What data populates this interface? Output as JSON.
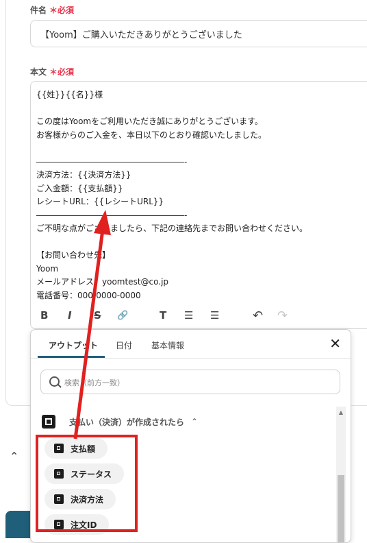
{
  "subject": {
    "label": "件名",
    "required": "＊必須",
    "value": "【Yoom】ご購入いただきありがとうございました"
  },
  "body": {
    "label": "本文",
    "required": "＊必須",
    "text": "{{姓}}{{名}}様\n\nこの度はYoomをご利用いただき誠にありがとうございます。\nお客様からのご入金を、本日以下のとおり確認いたしました。\n\n――――――――――――――――――-\n決済方法：{{決済方法}}\nご入金額：{{支払額}}\nレシートURL：{{レシートURL}}\n――――――――――――――――――-\nご不明な点がございましたら、下記の連絡先までお問い合わせください。\n\n【お問い合わせ先】\nYoom\nメールアドレス：yoomtest@co.jp\n電話番号：000-0000-0000"
  },
  "toolbar": {
    "bold": "B",
    "italic": "I",
    "strike": "S",
    "link": "🔗",
    "heading": "T",
    "bullet": "☰",
    "ordered": "☰",
    "undo": "↶",
    "redo": "↷"
  },
  "panel": {
    "tabs": [
      "アウトプット",
      "日付",
      "基本情報"
    ],
    "close": "✕",
    "search_placeholder": "検索（前方一致）",
    "group_label": "支払い（決済）が作成されたら",
    "group_chevron": "⌃",
    "items": [
      "支払額",
      "ステータス",
      "決済方法",
      "注文ID"
    ]
  },
  "colors": {
    "accent": "#1f5f7a",
    "required": "#e8334a",
    "highlight": "#e12020"
  }
}
